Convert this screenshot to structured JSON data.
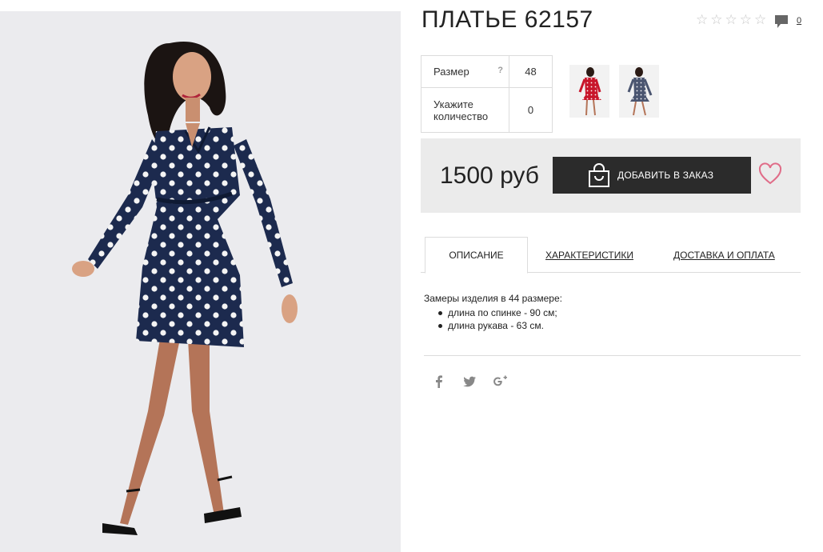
{
  "product": {
    "title": "ПЛАТЬЕ 62157",
    "comment_count": "0",
    "rating_stars": 0
  },
  "options": {
    "size_label": "Размер",
    "size_hint": "?",
    "size_value": "48",
    "qty_label_line1": "Укажите",
    "qty_label_line2": "количество",
    "qty_value": "0"
  },
  "thumbnails": [
    {
      "icon": "red-polka-dot-dress-thumbnail"
    },
    {
      "icon": "navy-polka-dot-dress-thumbnail"
    }
  ],
  "purchase": {
    "price": "1500 руб",
    "add_button_label": "ДОБАВИТЬ В ЗАКАЗ"
  },
  "tabs": [
    {
      "label": "ОПИСАНИЕ",
      "active": true
    },
    {
      "label": "ХАРАКТЕРИСТИКИ",
      "active": false
    },
    {
      "label": "ДОСТАВКА И ОПЛАТА",
      "active": false
    }
  ],
  "description": {
    "intro": "Замеры изделия в 44 размере:",
    "items": [
      "длина по спинке - 90 см;",
      "длина рукава - 63 см."
    ]
  },
  "social": [
    "facebook-icon",
    "twitter-icon",
    "google-plus-icon"
  ],
  "colors": {
    "dress_navy": "#1c2a4e",
    "button_dark": "#2b2b2b",
    "heart_pink": "#e06c88",
    "price_box": "#ebebeb"
  }
}
